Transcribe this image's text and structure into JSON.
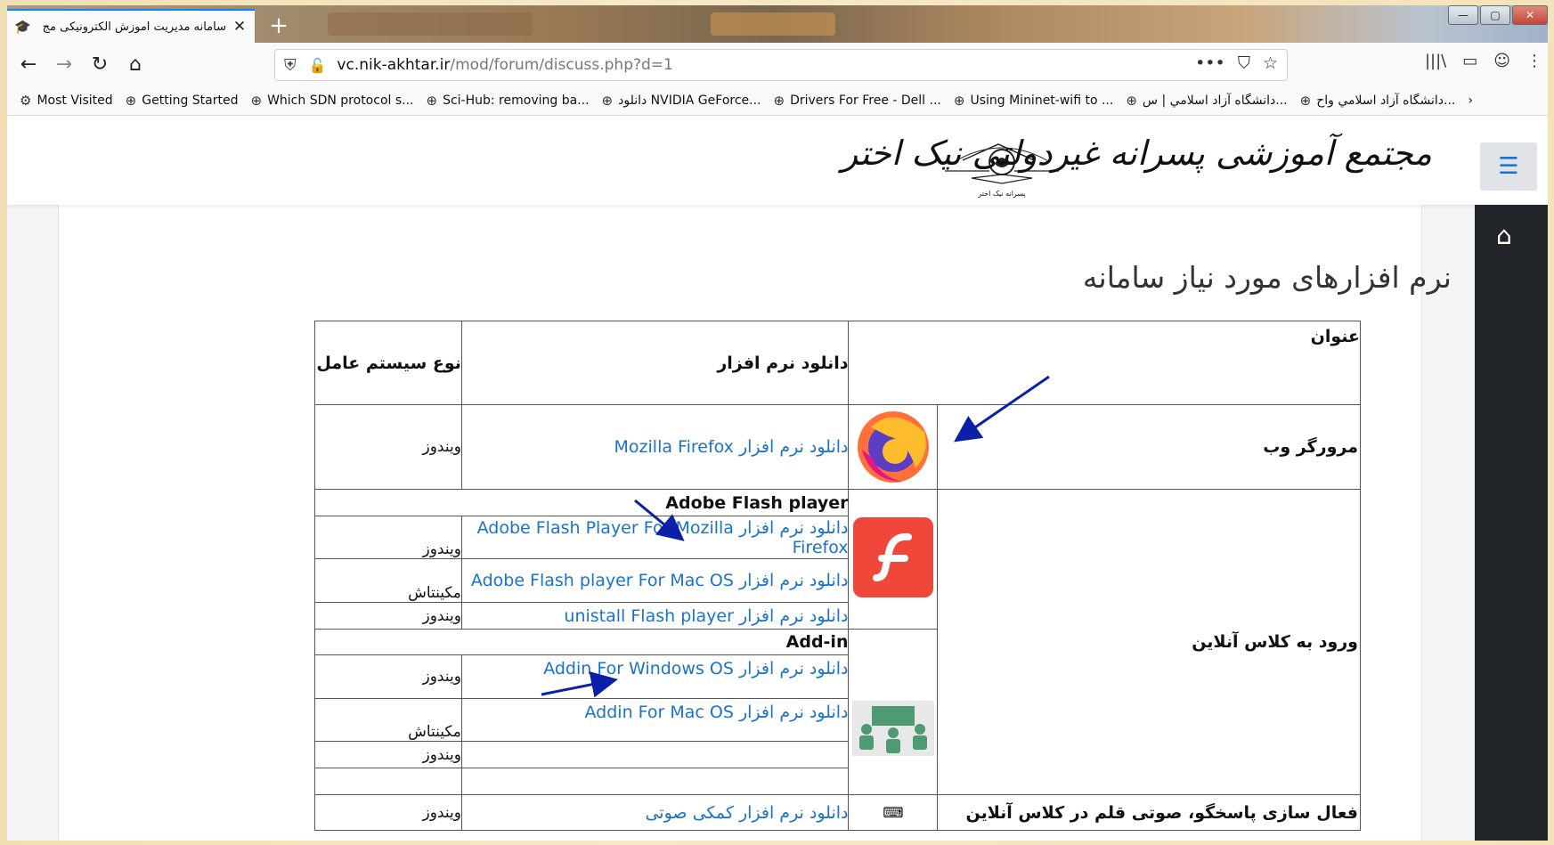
{
  "browser": {
    "tab": {
      "title": "سامانه مدیریت آموزش الکترونیکی مج",
      "close": "✕",
      "icon": "graduation-cap-icon"
    },
    "newtab": "+",
    "window_buttons": {
      "minimize": "—",
      "maximize": "▢",
      "close": "✕"
    },
    "nav": {
      "back": "←",
      "forward": "→",
      "reload": "↻",
      "home": "⌂"
    },
    "url": {
      "host": "vc.nik-akhtar.ir",
      "path": "/mod/forum/discuss.php?d=1"
    },
    "url_actions": {
      "more": "•••",
      "pocket": "⛉",
      "bookmark": "☆"
    },
    "toolbar_right": {
      "library": "|||\\",
      "sidebar": "▭",
      "account": "☺",
      "menu": "⋮"
    },
    "bookmarks": [
      {
        "label": "Most Visited",
        "icon": "⚙"
      },
      {
        "label": "Getting Started",
        "icon": "⊕"
      },
      {
        "label": "Which SDN protocol s...",
        "icon": "⊕"
      },
      {
        "label": "Sci-Hub: removing ba...",
        "icon": "⊕"
      },
      {
        "label": "دانلود NVIDIA GeForce...",
        "icon": "⊕"
      },
      {
        "label": "Drivers For Free - Dell ...",
        "icon": "⊕"
      },
      {
        "label": "Using Mininet-wifi to ...",
        "icon": "⊕"
      },
      {
        "label": "دانشگاه آزاد اسلامي | س...",
        "icon": "⊕"
      },
      {
        "label": "دانشگاه آزاد اسلامي واح...",
        "icon": "⊕"
      }
    ],
    "bookmarks_overflow": "›"
  },
  "site": {
    "logo_text": "مجتمع آموزشی پسرانه غیردولتی نیک اختر",
    "emblem_caption": "پسرانه نیک اختر",
    "menu_icon": "☰",
    "home_icon": "⌂"
  },
  "content": {
    "title": "نرم افزارهای مورد نیاز سامانه",
    "headers": {
      "title": "عنوان",
      "download": "دانلود نرم افزار",
      "os": "نوع سیستم عامل"
    },
    "browser_row": {
      "category": "مرورگر وب",
      "link": "دانلود نرم افزار Mozilla Firefox",
      "os": "ویندوز"
    },
    "online_class": {
      "category": "ورود به کلاس آنلاین",
      "flash_group": "Adobe Flash player",
      "flash_rows": [
        {
          "link": "دانلود نرم افزار Adobe Flash Player For Mozilla Firefox",
          "os": "ویندوز"
        },
        {
          "link": "دانلود نرم افزار  Adobe Flash player For Mac OS",
          "os": "مکینتاش"
        },
        {
          "link": "دانلود نرم افزار unistall Flash player",
          "os": "ویندوز"
        }
      ],
      "addin_group": "Add-in",
      "addin_rows": [
        {
          "link": "دانلود نرم افزار Addin For Windows OS",
          "os": "ویندوز"
        },
        {
          "link": "دانلود نرم افزار Addin For Mac OS",
          "os": "مکینتاش"
        },
        {
          "link": "",
          "os": "ویندوز"
        }
      ]
    },
    "last_row": {
      "category": "فعال سازی پاسخگو، صوتی قلم در کلاس آنلاین",
      "link": "دانلود نرم افزار کمکی صوتی",
      "os": "ویندوز"
    }
  },
  "colors": {
    "link": "#1a73c8",
    "sidebar": "#212529",
    "arrow": "#0b1fa8"
  }
}
